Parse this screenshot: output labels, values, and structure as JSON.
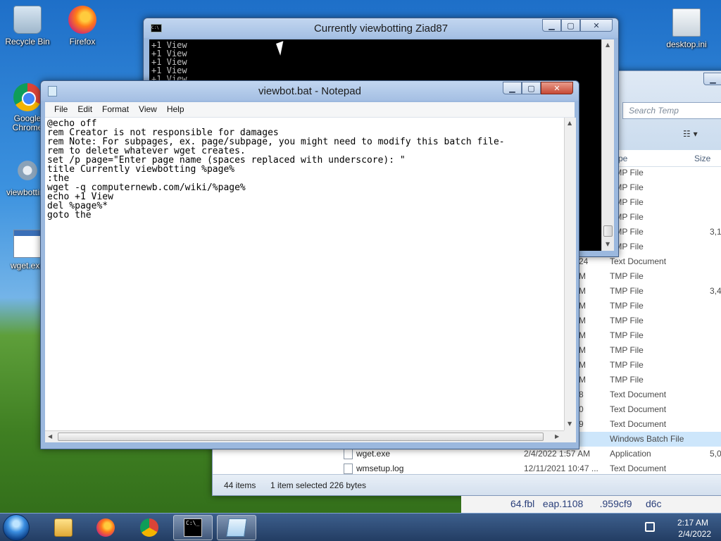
{
  "desktop": {
    "icons": [
      {
        "label": "Recycle Bin",
        "icon": "recycle-bin-icon"
      },
      {
        "label": "Firefox",
        "icon": "firefox-icon"
      },
      {
        "label": "Google Chrome",
        "icon": "chrome-icon"
      },
      {
        "label": "viewbotting",
        "icon": "batch-file-icon"
      },
      {
        "label": "wget.exe",
        "icon": "exe-icon"
      },
      {
        "label": "desktop.ini",
        "icon": "ini-file-icon"
      }
    ]
  },
  "cmd_window": {
    "title": "Currently viewbotting Ziad87",
    "lines": [
      "+1 View",
      "+1 View",
      "+1 View",
      "+1 View",
      "+1 View"
    ]
  },
  "explorer": {
    "search_placeholder": "Search Temp",
    "columns": {
      "type": "ype",
      "size": "Size"
    },
    "rows": [
      {
        "date": "",
        "type": "TMP File",
        "size": ""
      },
      {
        "date": "",
        "type": "TMP File",
        "size": ""
      },
      {
        "date": "",
        "type": "TMP File",
        "size": ""
      },
      {
        "date": "",
        "type": "TMP File",
        "size": ""
      },
      {
        "date": "",
        "type": "TMP File",
        "size": "3,1"
      },
      {
        "date": "",
        "type": "TMP File",
        "size": ""
      },
      {
        "date": "24",
        "type": "Text Document",
        "size": ""
      },
      {
        "date": "M",
        "type": "TMP File",
        "size": ""
      },
      {
        "date": "M",
        "type": "TMP File",
        "size": "3,4"
      },
      {
        "date": "M",
        "type": "TMP File",
        "size": ""
      },
      {
        "date": "M",
        "type": "TMP File",
        "size": ""
      },
      {
        "date": "M",
        "type": "TMP File",
        "size": ""
      },
      {
        "date": "M",
        "type": "TMP File",
        "size": ""
      },
      {
        "date": "M",
        "type": "TMP File",
        "size": ""
      },
      {
        "date": "M",
        "type": "TMP File",
        "size": ""
      },
      {
        "date": "8",
        "type": "Text Document",
        "size": ""
      },
      {
        "date": "0",
        "type": "Text Document",
        "size": ""
      },
      {
        "date": "9",
        "type": "Text Document",
        "size": ""
      },
      {
        "date": "",
        "type": "Windows Batch File",
        "size": ""
      },
      {
        "name": "wget.exe",
        "date": "2/4/2022 1:57 AM",
        "type": "Application",
        "size": "5,0"
      },
      {
        "name": "wmsetup.log",
        "date": "12/11/2021 10:47 ...",
        "type": "Text Document",
        "size": ""
      }
    ],
    "status": {
      "items": "44 items",
      "selected": "1 item selected",
      "bytes": "226 bytes"
    }
  },
  "notepad": {
    "title": "viewbot.bat - Notepad",
    "menu": [
      "File",
      "Edit",
      "Format",
      "View",
      "Help"
    ],
    "content": "@echo off\nrem Creator is not responsible for damages\nrem Note: For subpages, ex. page/subpage, you might need to modify this batch file-\nrem to delete whatever wget creates.\nset /p page=\"Enter page name (spaces replaced with underscore): \"\ntitle Currently viewbotting %page%\n:the\nwget -q computernewb.com/wiki/%page%\necho +1 View\ndel %page%*\ngoto the"
  },
  "wallpaper_text": "64.fbl   eap.1108      .959cf9     d6c",
  "taskbar": {
    "apps": [
      "explorer-icon",
      "firefox-icon",
      "chrome-icon",
      "cmd-icon",
      "notepad-icon"
    ],
    "time": "2:17 AM",
    "date": "2/4/2022"
  },
  "colors": {
    "accent": "#3b8ee0",
    "selection": "#cde6fb",
    "close": "#c74a36"
  }
}
